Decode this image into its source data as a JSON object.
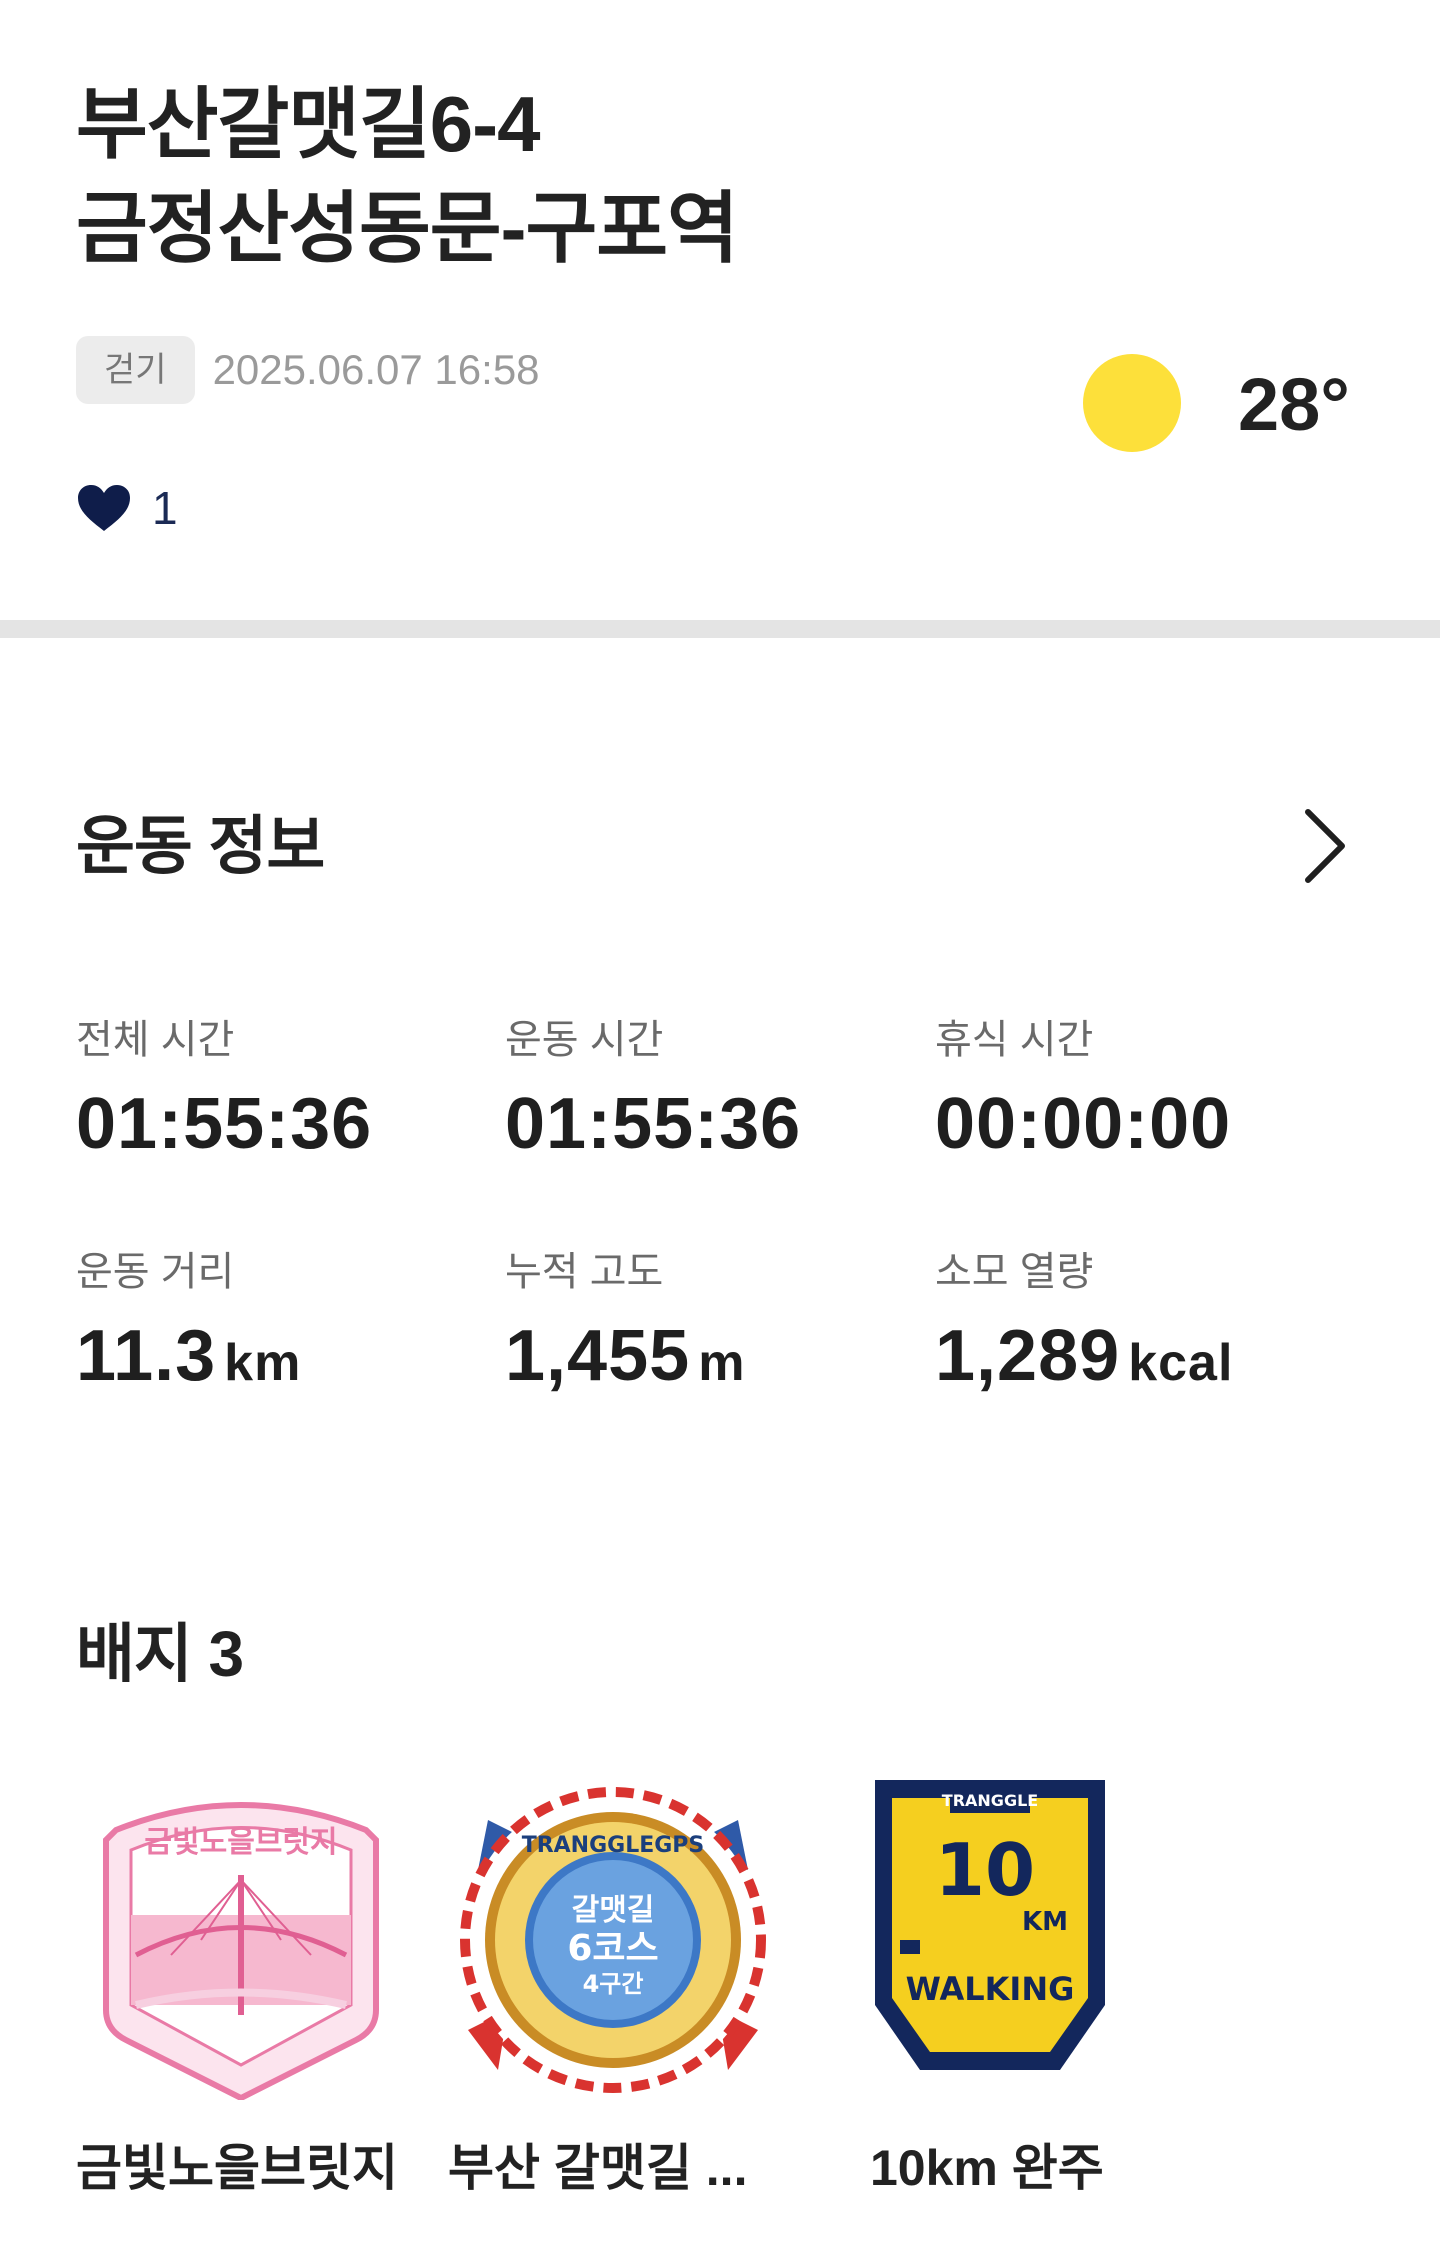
{
  "activity": {
    "title_line1": "부산갈맷길6-4",
    "title_line2": "금정산성동문-구포역",
    "type_tag": "걷기",
    "datetime": "2025.06.07 16:58",
    "like_count": "1",
    "weather": {
      "icon": "sun-icon",
      "temperature": "28°"
    }
  },
  "exercise_info": {
    "title": "운동 정보",
    "stats": [
      {
        "label": "전체 시간",
        "value": "01:55:36",
        "unit": ""
      },
      {
        "label": "운동 시간",
        "value": "01:55:36",
        "unit": ""
      },
      {
        "label": "휴식 시간",
        "value": "00:00:00",
        "unit": ""
      },
      {
        "label": "운동 거리",
        "value": "11.3",
        "unit": "km"
      },
      {
        "label": "누적 고도",
        "value": "1,455",
        "unit": "m"
      },
      {
        "label": "소모 열량",
        "value": "1,289",
        "unit": "kcal"
      }
    ]
  },
  "badges": {
    "title": "배지 3",
    "items": [
      {
        "name": "금빛노을브릿지",
        "image_text": "금빛노을브릿지"
      },
      {
        "name": "부산 갈맷길 ...",
        "image_text_ring": "TRANGGLEGPS",
        "image_text_main": "갈맷길",
        "image_text_sub": "6코스",
        "image_text_sub2": "4구간"
      },
      {
        "name": "10km 완주",
        "image_brand": "TRANGGLE",
        "image_number": "10",
        "image_unit": "KM",
        "image_word": "WALKING"
      }
    ]
  },
  "colors": {
    "sun": "#fde03a",
    "heart": "#0f1d4a",
    "badge_pink": "#e97aa6",
    "badge_navy": "#13275c",
    "badge_yellow": "#f5cf1f"
  }
}
